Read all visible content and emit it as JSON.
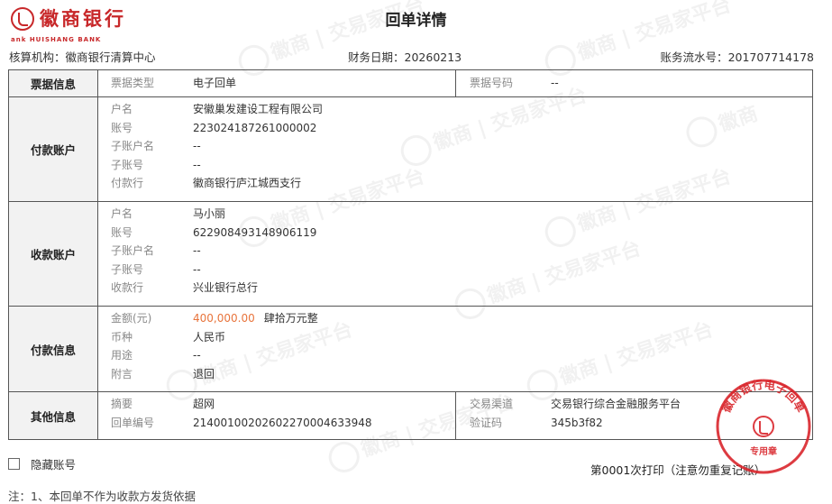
{
  "header": {
    "bank_name_cn": "徽商银行",
    "bank_name_en": "HUISHANG BANK",
    "logo_prefix": "ank",
    "title": "回单详情"
  },
  "meta": {
    "org_label": "核算机构：",
    "org_value": "徽商银行清算中心",
    "date_label": "财务日期：",
    "date_value": "20260213",
    "serial_label": "账务流水号：",
    "serial_value": "201707714178"
  },
  "bill": {
    "category": "票据信息",
    "type_label": "票据类型",
    "type_value": "电子回单",
    "no_label": "票据号码",
    "no_value": "--"
  },
  "payer": {
    "category": "付款账户",
    "fields": [
      {
        "label": "户名",
        "value": "安徽巢发建设工程有限公司"
      },
      {
        "label": "账号",
        "value": "223024187261000002"
      },
      {
        "label": "子账户名",
        "value": "--"
      },
      {
        "label": "子账号",
        "value": "--"
      },
      {
        "label": "付款行",
        "value": "徽商银行庐江城西支行"
      }
    ]
  },
  "payee": {
    "category": "收款账户",
    "fields": [
      {
        "label": "户名",
        "value": "马小丽"
      },
      {
        "label": "账号",
        "value": "622908493148906119"
      },
      {
        "label": "子账户名",
        "value": "--"
      },
      {
        "label": "子账号",
        "value": "--"
      },
      {
        "label": "收款行",
        "value": "兴业银行总行"
      }
    ]
  },
  "payment": {
    "category": "付款信息",
    "amount_label": "金额(元)",
    "amount_value": "400,000.00",
    "amount_capital": "肆拾万元整",
    "currency_label": "币种",
    "currency_value": "人民币",
    "purpose_label": "用途",
    "purpose_value": "--",
    "remark_label": "附言",
    "remark_value": "退回"
  },
  "other": {
    "category": "其他信息",
    "summary_label": "摘要",
    "summary_value": "超网",
    "receipt_no_label": "回单编号",
    "receipt_no_value": "21400100202602270004633948",
    "channel_label": "交易渠道",
    "channel_value": "交易银行综合金融服务平台",
    "verify_label": "验证码",
    "verify_value": "345b3f82"
  },
  "stamp": {
    "text": "徽商银行电子回单",
    "sub": "专用章"
  },
  "footer": {
    "hide_account_label": "隐藏账号",
    "print_info": "第0001次打印（注意勿重复记账）",
    "note": "注：1、本回单不作为收款方发货依据"
  },
  "colors": {
    "brand_red": "#c8282a",
    "amount_orange": "#e8743c"
  }
}
